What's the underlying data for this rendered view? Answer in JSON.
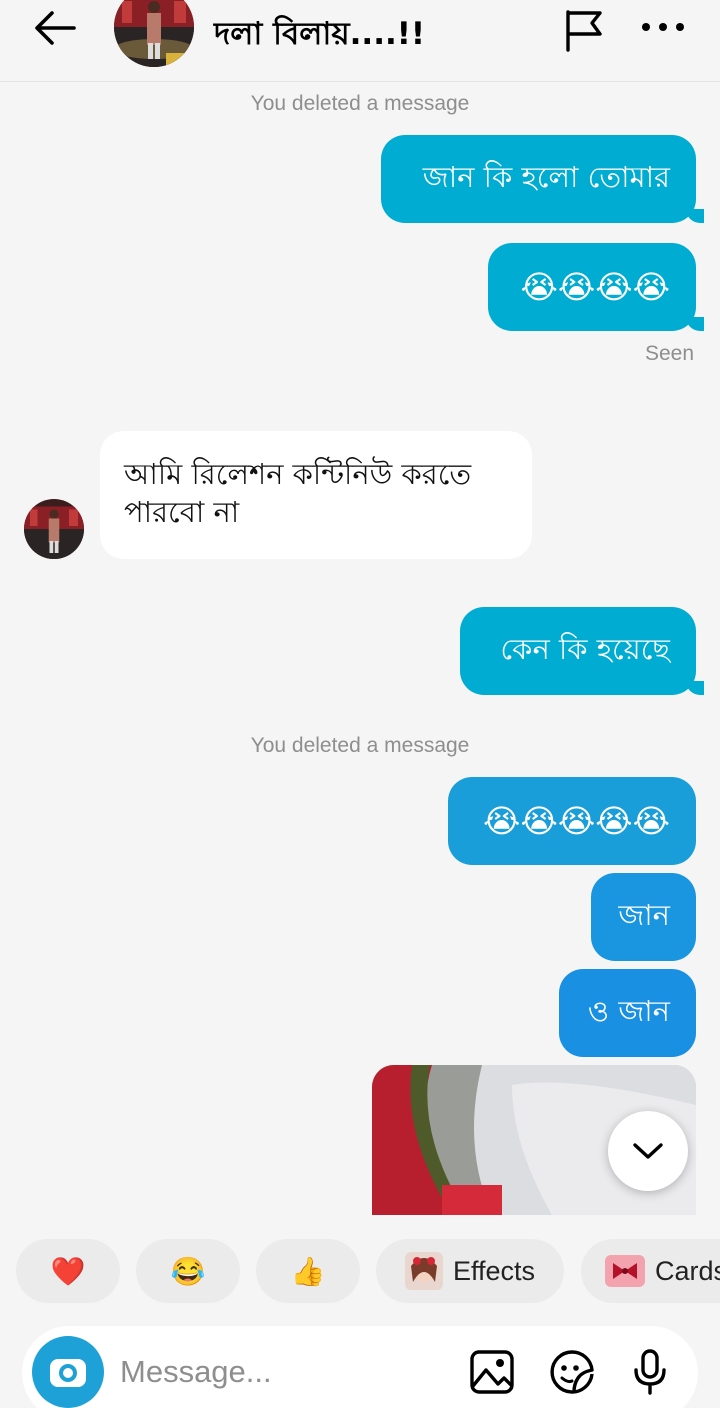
{
  "header": {
    "title": "দলা বিলায়....!!",
    "back_icon": "arrow-left-icon",
    "flag_icon": "flag-icon",
    "more_icon": "more-horizontal-icon"
  },
  "messages": {
    "deleted_1": "You deleted a message",
    "out_1": "জান কি হলো তোমার",
    "out_2": "😭😭😭😭",
    "seen": "Seen",
    "in_1": "আমি রিলেশন কন্টিনিউ করতে পারবো না",
    "out_3": "কেন কি হয়েছে",
    "deleted_2": "You deleted a message",
    "out_4": "😭😭😭😭😭",
    "out_5": "জান",
    "out_6": "ও জান"
  },
  "reactions": {
    "heart": "❤️",
    "laugh": "😂",
    "thumbs": "👍",
    "effects": "Effects",
    "cards": "Cards"
  },
  "composer": {
    "placeholder": "Message...",
    "camera_icon": "camera-icon",
    "gallery_icon": "image-icon",
    "sticker_icon": "sticker-icon",
    "mic_icon": "microphone-icon"
  },
  "colors": {
    "bubble_cyan": "#00acd1",
    "bubble_blue": "#1a90e3",
    "camera": "#1da1d6",
    "background": "#f5f5f5"
  }
}
